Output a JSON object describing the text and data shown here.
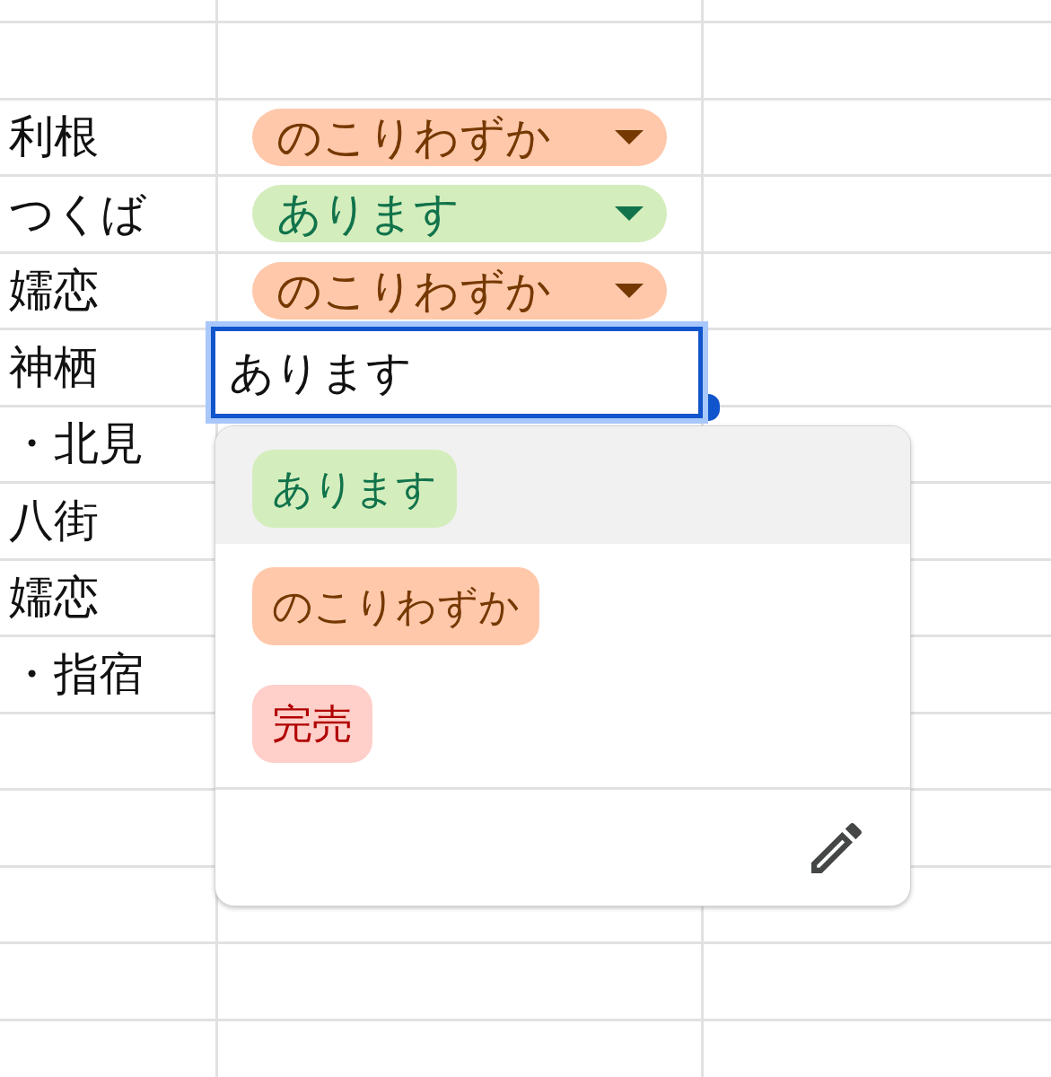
{
  "sheet": {
    "rows": [
      {
        "column_1": "利根",
        "column_2": {
          "kind": "dropdown",
          "value": "のこりわずか",
          "color": "#ffc8aa"
        }
      },
      {
        "column_1": "つくば",
        "column_2": {
          "kind": "dropdown",
          "value": "あります",
          "color": "#d4edbc"
        }
      },
      {
        "column_1": "嬬恋",
        "column_2": {
          "kind": "dropdown",
          "value": "のこりわずか",
          "color": "#ffc8aa"
        }
      },
      {
        "column_1": "神栖",
        "column_2": {
          "kind": "editor",
          "value": "あります",
          "menu": {
            "options": [
              {
                "label": "あります",
                "color": "#d4edbc",
                "selected": true
              },
              {
                "label": "のこりわずか",
                "color": "#ffc8aa",
                "selected": false
              },
              {
                "label": "完売",
                "color": "#ffcfc9",
                "selected": false
              }
            ]
          }
        }
      },
      {
        "column_1": "・北見"
      },
      {
        "column_1": "八街"
      },
      {
        "column_1": "嬬恋"
      },
      {
        "column_1": "・指宿"
      }
    ]
  }
}
